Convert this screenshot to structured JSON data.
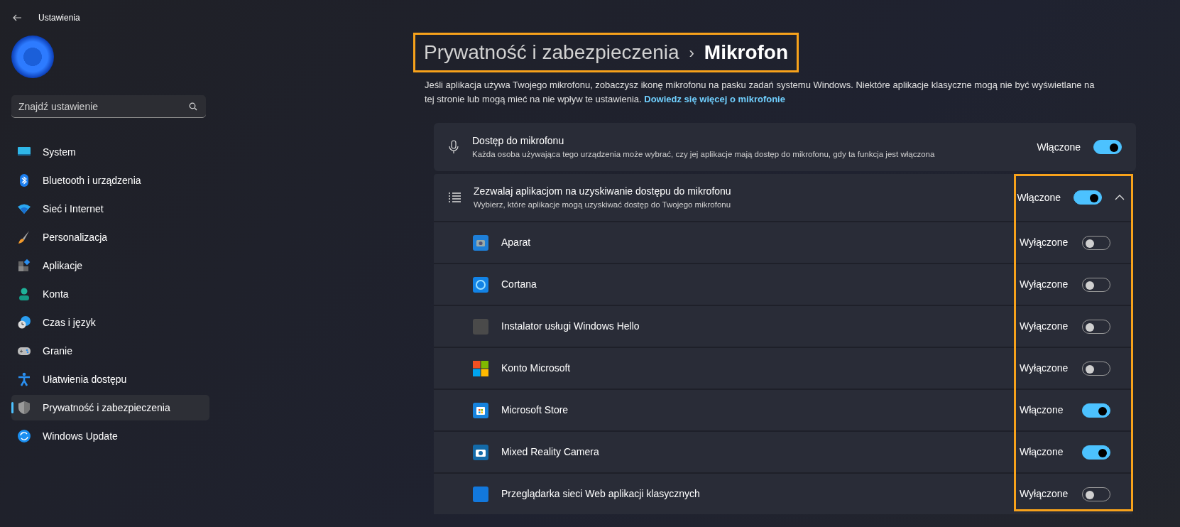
{
  "window": {
    "title": "Ustawienia"
  },
  "search": {
    "placeholder": "Znajdź ustawienie"
  },
  "sidebar": {
    "items": [
      {
        "label": "System",
        "selected": false
      },
      {
        "label": "Bluetooth i urządzenia",
        "selected": false
      },
      {
        "label": "Sieć i Internet",
        "selected": false
      },
      {
        "label": "Personalizacja",
        "selected": false
      },
      {
        "label": "Aplikacje",
        "selected": false
      },
      {
        "label": "Konta",
        "selected": false
      },
      {
        "label": "Czas i język",
        "selected": false
      },
      {
        "label": "Granie",
        "selected": false
      },
      {
        "label": "Ułatwienia dostępu",
        "selected": false
      },
      {
        "label": "Prywatność i zabezpieczenia",
        "selected": true
      },
      {
        "label": "Windows Update",
        "selected": false
      }
    ]
  },
  "breadcrumb": {
    "parent": "Prywatność i zabezpieczenia",
    "separator": "›",
    "current": "Mikrofon",
    "highlighted": true
  },
  "description": {
    "text": "Jeśli aplikacja używa Twojego mikrofonu, zobaczysz ikonę mikrofonu na pasku zadań systemu Windows. Niektóre aplikacje klasyczne mogą nie być wyświetlane na tej stronie lub mogą mieć na nie wpływ te ustawienia.",
    "link": "Dowiedz się więcej o mikrofonie"
  },
  "access_card": {
    "title": "Dostęp do mikrofonu",
    "subtitle": "Każda osoba używająca tego urządzenia może wybrać, czy jej aplikacje mają dostęp do mikrofonu, gdy ta funkcja jest włączona",
    "state_label": "Włączone",
    "on": true
  },
  "apps_card": {
    "title": "Zezwalaj aplikacjom na uzyskiwanie dostępu do mikrofonu",
    "subtitle": "Wybierz, które aplikacje mogą uzyskiwać dostęp do Twojego mikrofonu",
    "state_label": "Włączone",
    "on": true,
    "expanded": true,
    "toggles_highlighted": true,
    "apps": [
      {
        "name": "Aparat",
        "state_label": "Wyłączone",
        "on": false
      },
      {
        "name": "Cortana",
        "state_label": "Wyłączone",
        "on": false
      },
      {
        "name": "Instalator usługi Windows Hello",
        "state_label": "Wyłączone",
        "on": false
      },
      {
        "name": "Konto Microsoft",
        "state_label": "Wyłączone",
        "on": false
      },
      {
        "name": "Microsoft Store",
        "state_label": "Włączone",
        "on": true
      },
      {
        "name": "Mixed Reality Camera",
        "state_label": "Włączone",
        "on": true
      },
      {
        "name": "Przeglądarka sieci Web aplikacji klasycznych",
        "state_label": "Wyłączone",
        "on": false
      }
    ]
  }
}
